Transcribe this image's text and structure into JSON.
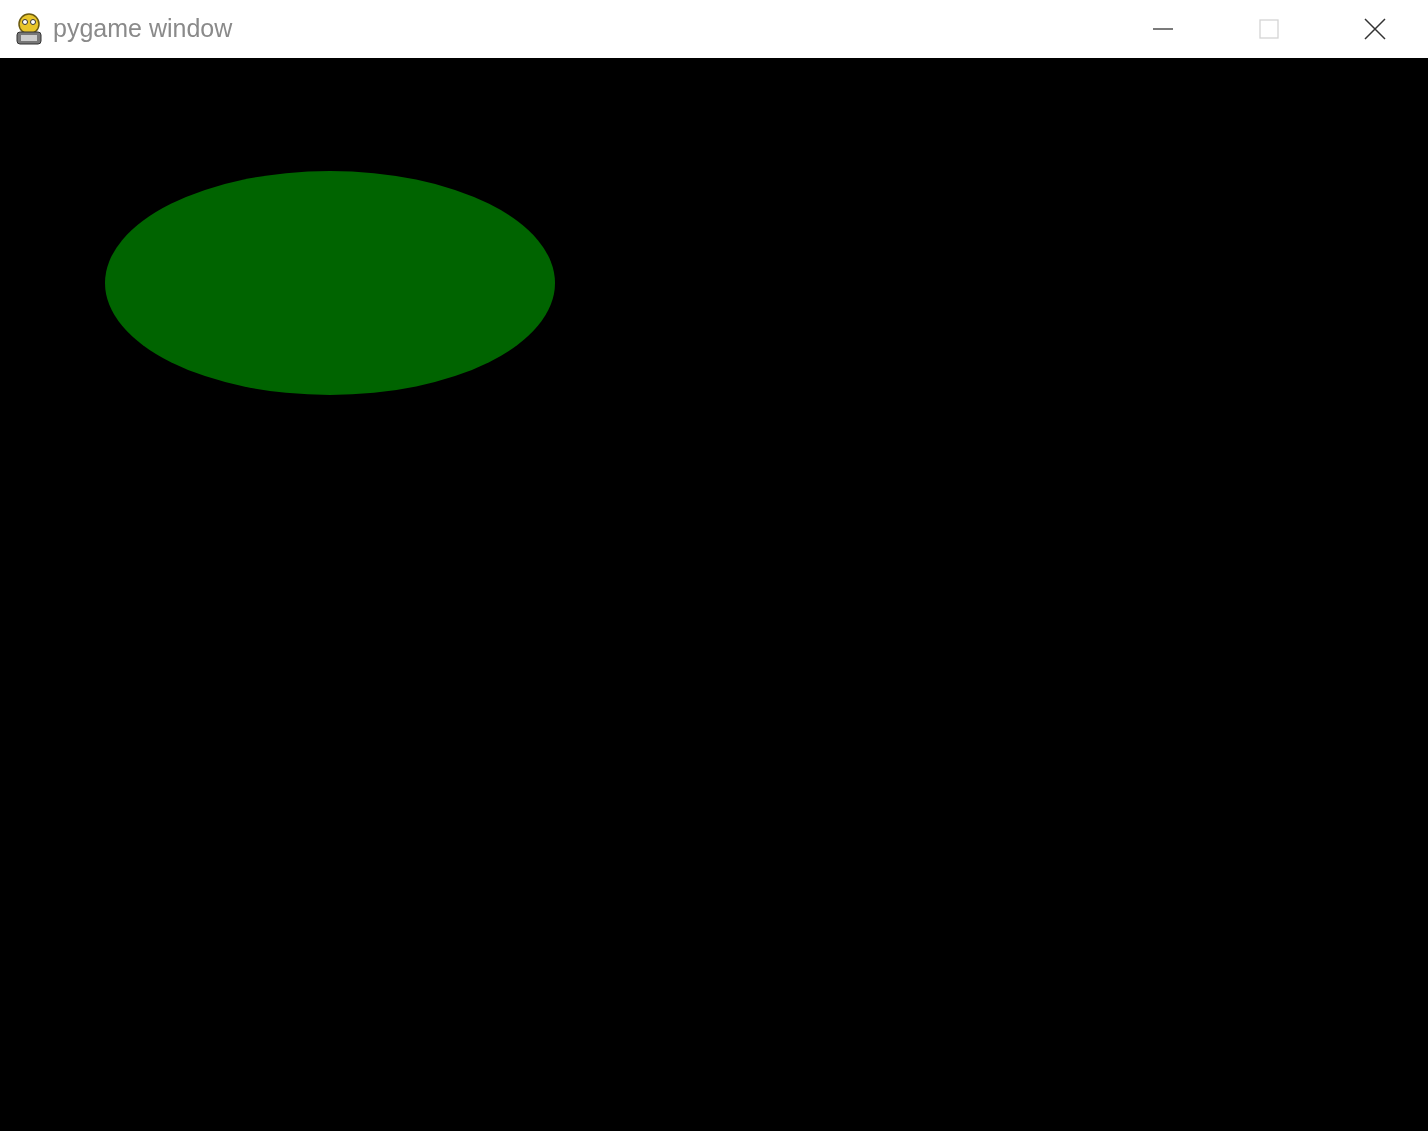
{
  "window": {
    "title": "pygame window",
    "controls": [
      {
        "kind": "minimize",
        "disabled": false
      },
      {
        "kind": "maximize",
        "disabled": true
      },
      {
        "kind": "close",
        "disabled": false
      }
    ]
  }
}
